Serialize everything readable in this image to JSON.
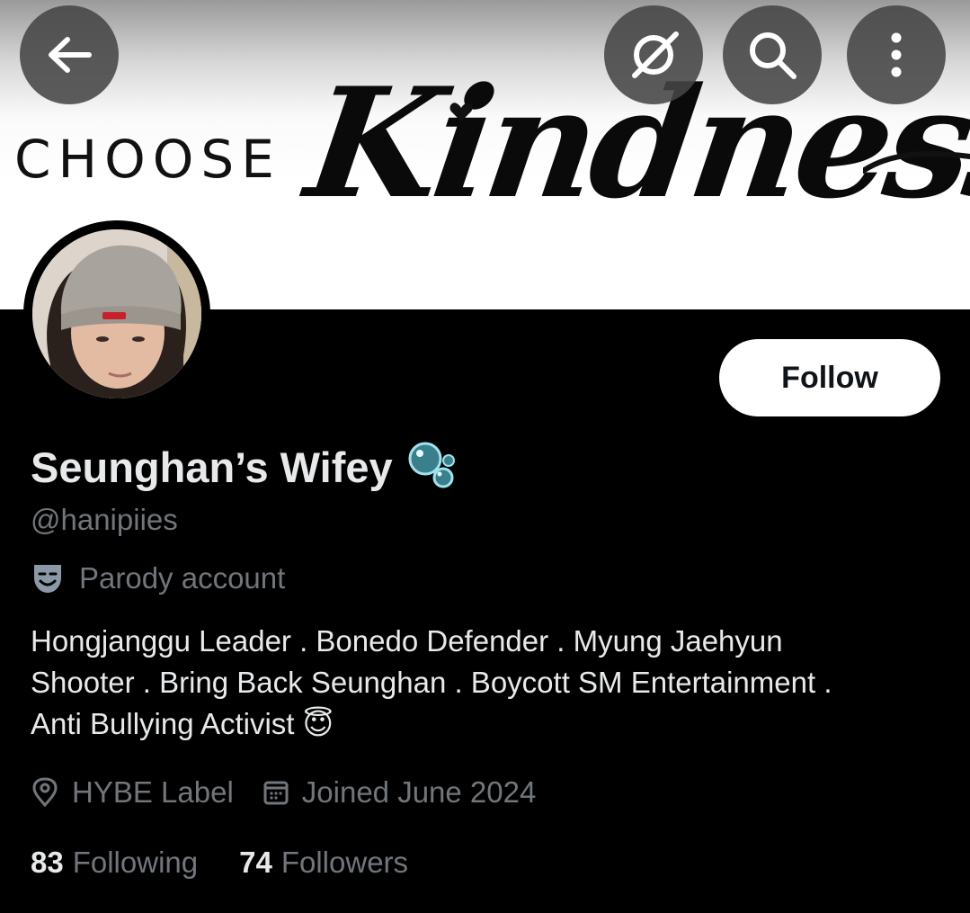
{
  "banner": {
    "choose_text": "CHOOSE",
    "kindness_text": "Kindness"
  },
  "header": {
    "back_icon": "arrow-left-icon",
    "grok_icon": "grok-icon",
    "search_icon": "search-icon",
    "more_icon": "more-vertical-icon"
  },
  "profile": {
    "display_name": "Seunghan’s Wifey",
    "name_emoji": "🫧",
    "handle": "@hanipiies",
    "parody_label": "Parody account",
    "parody_icon": "theater-mask-icon",
    "bio_lines": [
      "Hongjanggu Leader . Bonedo Defender . Myung Jaehyun",
      "Shooter . Bring Back Seunghan . Boycott SM Entertainment .",
      "Anti Bullying Activist"
    ],
    "bio_emoji": "😇",
    "location": "HYBE Label",
    "location_icon": "location-pin-icon",
    "joined": "Joined June 2024",
    "joined_icon": "calendar-icon",
    "following_count": "83",
    "following_label": "Following",
    "followers_count": "74",
    "followers_label": "Followers"
  },
  "actions": {
    "follow_label": "Follow"
  },
  "colors": {
    "background": "#000000",
    "primary_text": "#e7e9ea",
    "secondary_text": "#71767b",
    "button_bg": "#ffffff",
    "button_text": "#0f1419"
  }
}
